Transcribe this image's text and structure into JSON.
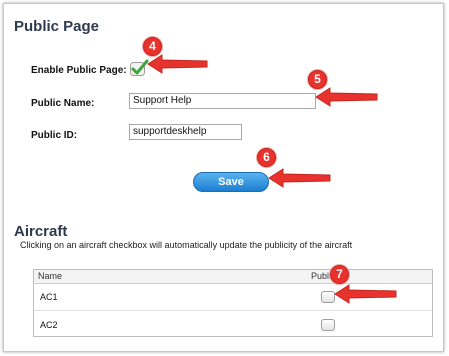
{
  "public_page": {
    "title": "Public Page",
    "enable_label": "Enable Public Page:",
    "enable_checked": true,
    "name_label": "Public Name:",
    "name_value": "Support Help",
    "id_label": "Public ID:",
    "id_value": "supportdeskhelp",
    "save_label": "Save"
  },
  "aircraft": {
    "title": "Aircraft",
    "description": "Clicking on an aircraft checkbox will automatically update the publicity of the aircraft",
    "columns": [
      "Name",
      "Public"
    ],
    "rows": [
      {
        "name": "AC1",
        "public": false
      },
      {
        "name": "AC2",
        "public": false
      }
    ]
  },
  "callouts": [
    "4",
    "5",
    "6",
    "7"
  ],
  "colors": {
    "title": "#2e3a4e",
    "save_button": "#2a8ee0",
    "callout": "#e8322d"
  }
}
